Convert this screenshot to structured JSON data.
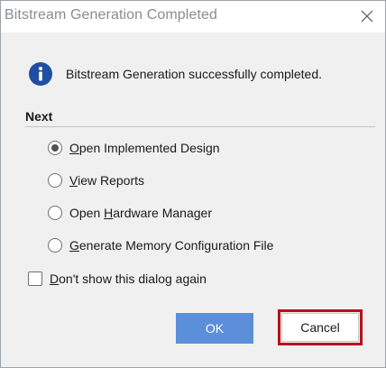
{
  "window": {
    "title": "Bitstream Generation Completed",
    "close_icon": "close-icon"
  },
  "message": {
    "icon": "info-icon",
    "icon_color": "#1f4fa3",
    "text": "Bitstream Generation successfully completed."
  },
  "next": {
    "label": "Next",
    "options": [
      {
        "pre": "",
        "mnemonic": "O",
        "post": "pen Implemented Design",
        "selected": true
      },
      {
        "pre": "",
        "mnemonic": "V",
        "post": "iew Reports",
        "selected": false
      },
      {
        "pre": "Open ",
        "mnemonic": "H",
        "post": "ardware Manager",
        "selected": false
      },
      {
        "pre": "",
        "mnemonic": "G",
        "post": "enerate Memory Configuration File",
        "selected": false
      }
    ]
  },
  "dont_show": {
    "pre": "",
    "mnemonic": "D",
    "post": "on't show this dialog again",
    "checked": false
  },
  "buttons": {
    "ok_label": "OK",
    "cancel_label": "Cancel",
    "ok_color": "#5b8fd9",
    "highlight_color": "#b5121b"
  }
}
